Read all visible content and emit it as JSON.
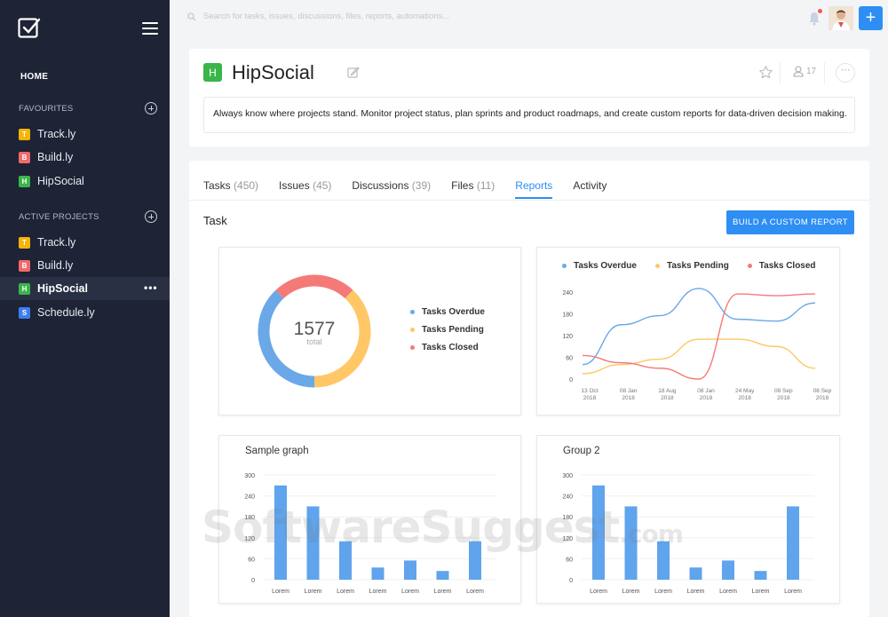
{
  "sidebar": {
    "home": "HOME",
    "favourites_header": "FAVOURITES",
    "favourites": [
      {
        "letter": "T",
        "name": "Track.ly",
        "color": "#f5b40a"
      },
      {
        "letter": "B",
        "name": "Build.ly",
        "color": "#f06a6a"
      },
      {
        "letter": "H",
        "name": "HipSocial",
        "color": "#3ab54a"
      }
    ],
    "active_header": "ACTIVE PROJECTS",
    "active": [
      {
        "letter": "T",
        "name": "Track.ly",
        "color": "#f5b40a"
      },
      {
        "letter": "B",
        "name": "Build.ly",
        "color": "#f06a6a"
      },
      {
        "letter": "H",
        "name": "HipSocial",
        "color": "#3ab54a"
      },
      {
        "letter": "S",
        "name": "Schedule.ly",
        "color": "#3c7ef0"
      }
    ],
    "active_dots": "•••"
  },
  "topbar": {
    "search_placeholder": "Search for tasks, issues, discussions, files, reports, automations...",
    "add_label": "+"
  },
  "project": {
    "badge": "H",
    "title": "HipSocial",
    "members": "17",
    "more": "···",
    "description": "Always know where projects stand. Monitor project status, plan sprints and product roadmaps, and create custom reports for data-driven decision making."
  },
  "tabs": [
    {
      "label": "Tasks",
      "count": "(450)"
    },
    {
      "label": "Issues",
      "count": "(45)"
    },
    {
      "label": "Discussions",
      "count": "(39)"
    },
    {
      "label": "Files",
      "count": "(11)"
    },
    {
      "label": "Reports",
      "count": ""
    },
    {
      "label": "Activity",
      "count": ""
    }
  ],
  "active_tab": "Reports",
  "section_title": "Task",
  "build_button": "BUILD A CUSTOM REPORT",
  "colors": {
    "overdue": "#6aa8e8",
    "pending": "#ffc766",
    "closed": "#f47a78",
    "accent": "#2e8ef3"
  },
  "watermark": {
    "main": "SoftwareSuggest",
    "suffix": ".com"
  },
  "chart_data": [
    {
      "type": "pie",
      "total": "1577",
      "total_label": "total",
      "labels": [
        "Tasks Overdue",
        "Tasks Pending",
        "Tasks Closed"
      ],
      "values": [
        38,
        38,
        24
      ]
    },
    {
      "type": "line",
      "categories": [
        "13 Oct|2018",
        "08 Jan|2018",
        "18 Aug|2018",
        "08 Jan|2018",
        "24 May|2018",
        "08 Sep|2018",
        "08 Sep|2018"
      ],
      "yticks": [
        0,
        60,
        120,
        180,
        240
      ],
      "ylim": [
        0,
        240
      ],
      "legend": "top",
      "series": [
        {
          "name": "Tasks Overdue",
          "values": [
            40,
            150,
            175,
            250,
            165,
            160,
            210
          ]
        },
        {
          "name": "Tasks Pending",
          "values": [
            15,
            40,
            55,
            110,
            110,
            90,
            30
          ]
        },
        {
          "name": "Tasks Closed",
          "values": [
            65,
            45,
            30,
            0,
            235,
            230,
            235
          ]
        }
      ]
    },
    {
      "type": "bar",
      "title": "Sample graph",
      "categories": [
        "Lorem",
        "Lorem",
        "Lorem",
        "Lorem",
        "Lorem",
        "Lorem",
        "Lorem"
      ],
      "values": [
        270,
        210,
        110,
        35,
        55,
        25,
        110
      ],
      "yticks": [
        0,
        60,
        120,
        180,
        240,
        300
      ],
      "ylim": [
        0,
        300
      ]
    },
    {
      "type": "bar",
      "title": "Group 2",
      "categories": [
        "Lorem",
        "Lorem",
        "Lorem",
        "Lorem",
        "Lorem",
        "Lorem",
        "Lorem"
      ],
      "values": [
        270,
        210,
        110,
        35,
        55,
        25,
        210
      ],
      "yticks": [
        0,
        60,
        120,
        180,
        240,
        300
      ],
      "ylim": [
        0,
        300
      ]
    }
  ]
}
